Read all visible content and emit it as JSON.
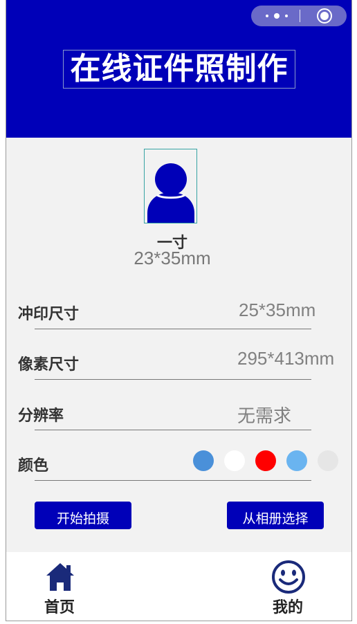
{
  "header": {
    "title": "在线证件照制作",
    "background_color": "#0000b8"
  },
  "photo": {
    "icon": "person-silhouette-icon",
    "size_name": "一寸",
    "size_dimensions": "23*35mm"
  },
  "specs": [
    {
      "label": "冲印尺寸",
      "value": "25*35mm"
    },
    {
      "label": "像素尺寸",
      "value": "295*413mm"
    },
    {
      "label": "分辨率",
      "value": "无需求"
    }
  ],
  "color_row": {
    "label": "颜色",
    "swatches": [
      "#4a90d9",
      "#ffffff",
      "#ff0000",
      "#6ab4f0",
      "#e6e6e6"
    ]
  },
  "actions": {
    "take_photo": "开始拍摄",
    "choose_album": "从相册选择"
  },
  "tabbar": {
    "home_label": "首页",
    "home_icon": "home-icon",
    "mine_label": "我的",
    "mine_icon": "smiley-icon",
    "icon_color": "#1a2a7a"
  }
}
